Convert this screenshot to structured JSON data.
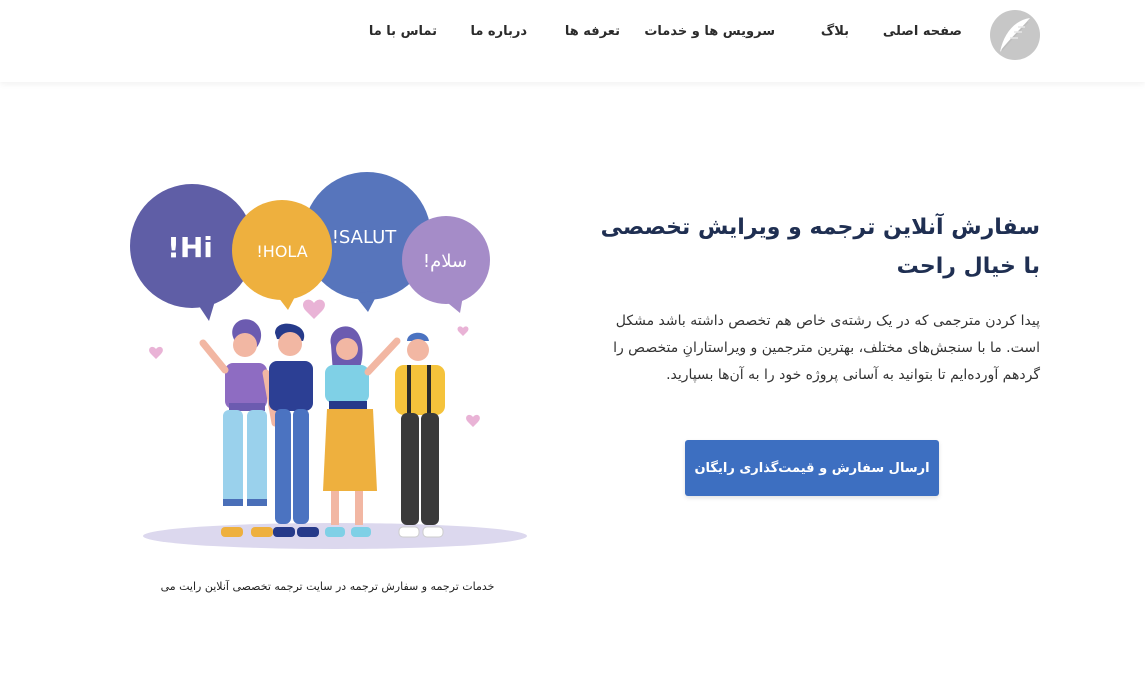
{
  "nav": {
    "items": [
      {
        "label": "صفحه اصلی"
      },
      {
        "label": "بلاگ"
      },
      {
        "label": "سرویس ها و خدمات"
      },
      {
        "label": "تعرفه ها"
      },
      {
        "label": "درباره ما"
      },
      {
        "label": "تماس با ما"
      }
    ]
  },
  "hero": {
    "title": "سفارش آنلاین ترجمه و ویرایش تخصصی با خیال راحت",
    "text": "پیدا کردن مترجمی که در یک رشته‌ی خاص هم تخصص داشته باشد مشکل است. ما با سنجش‌های مختلف، بهترین مترجمین و ویراستارانِ متخصص را گردهم آورده‌ایم تا بتوانید به آسانی پروژه خود را به آن‌ها بسپارید.",
    "cta_label": "ارسال سفارش و قیمت‌گذاری رایگان"
  },
  "illustration": {
    "bubbles": [
      "Hi!",
      "HOLA!",
      "SALUT!",
      "سلام!"
    ],
    "caption": "خدمات ترجمه و سفارش ترجمه در سایت ترجمه تخصصی آنلاین رایت می"
  },
  "colors": {
    "accent": "#3d6fc1",
    "title": "#1f2f52"
  }
}
